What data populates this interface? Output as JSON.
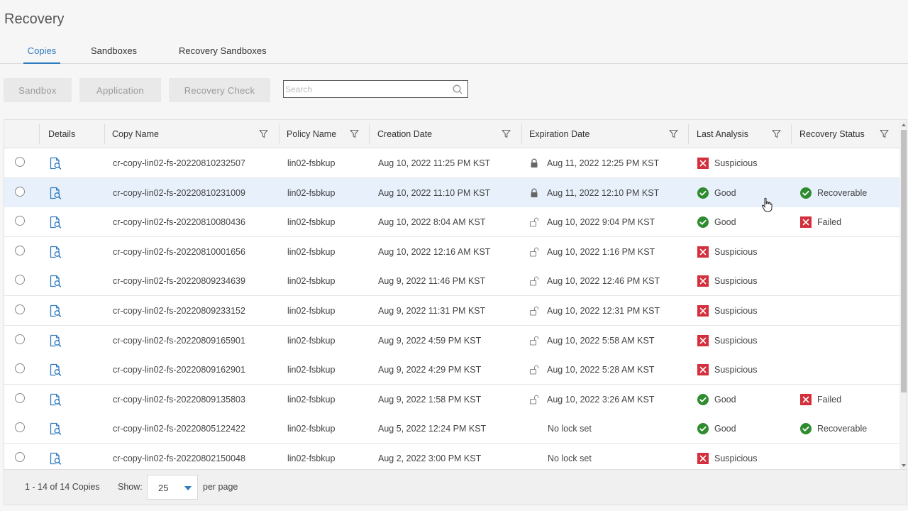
{
  "page": {
    "title": "Recovery"
  },
  "tabs": [
    {
      "label": "Copies",
      "active": true
    },
    {
      "label": "Sandboxes",
      "active": false
    },
    {
      "label": "Recovery Sandboxes",
      "active": false
    }
  ],
  "toolbar": {
    "sandbox_label": "Sandbox",
    "application_label": "Application",
    "recovery_check_label": "Recovery Check",
    "search_placeholder": "Search"
  },
  "columns": {
    "details": "Details",
    "copy_name": "Copy Name",
    "policy_name": "Policy Name",
    "creation_date": "Creation Date",
    "expiration_date": "Expiration Date",
    "last_analysis": "Last Analysis",
    "recovery_status": "Recovery Status"
  },
  "rows": [
    {
      "copy_name": "cr-copy-lin02-fs-20220810232507",
      "policy": "lin02-fsbkup",
      "created": "Aug 10, 2022 11:25 PM KST",
      "lock": "locked",
      "expires": "Aug 11, 2022 12:25 PM KST",
      "analysis": "Suspicious",
      "analysis_state": "bad",
      "recovery": "",
      "recovery_state": ""
    },
    {
      "copy_name": "cr-copy-lin02-fs-20220810231009",
      "policy": "lin02-fsbkup",
      "created": "Aug 10, 2022 11:10 PM KST",
      "lock": "locked",
      "expires": "Aug 11, 2022 12:10 PM KST",
      "analysis": "Good",
      "analysis_state": "good",
      "recovery": "Recoverable",
      "recovery_state": "good"
    },
    {
      "copy_name": "cr-copy-lin02-fs-20220810080436",
      "policy": "lin02-fsbkup",
      "created": "Aug 10, 2022 8:04 AM KST",
      "lock": "unlocked",
      "expires": "Aug 10, 2022 9:04 PM KST",
      "analysis": "Good",
      "analysis_state": "good",
      "recovery": "Failed",
      "recovery_state": "bad"
    },
    {
      "copy_name": "cr-copy-lin02-fs-20220810001656",
      "policy": "lin02-fsbkup",
      "created": "Aug 10, 2022 12:16 AM KST",
      "lock": "unlocked",
      "expires": "Aug 10, 2022 1:16 PM KST",
      "analysis": "Suspicious",
      "analysis_state": "bad",
      "recovery": "",
      "recovery_state": ""
    },
    {
      "copy_name": "cr-copy-lin02-fs-20220809234639",
      "policy": "lin02-fsbkup",
      "created": "Aug 9, 2022 11:46 PM KST",
      "lock": "unlocked",
      "expires": "Aug 10, 2022 12:46 PM KST",
      "analysis": "Suspicious",
      "analysis_state": "bad",
      "recovery": "",
      "recovery_state": ""
    },
    {
      "copy_name": "cr-copy-lin02-fs-20220809233152",
      "policy": "lin02-fsbkup",
      "created": "Aug 9, 2022 11:31 PM KST",
      "lock": "unlocked",
      "expires": "Aug 10, 2022 12:31 PM KST",
      "analysis": "Suspicious",
      "analysis_state": "bad",
      "recovery": "",
      "recovery_state": ""
    },
    {
      "copy_name": "cr-copy-lin02-fs-20220809165901",
      "policy": "lin02-fsbkup",
      "created": "Aug 9, 2022 4:59 PM KST",
      "lock": "unlocked",
      "expires": "Aug 10, 2022 5:58 AM KST",
      "analysis": "Suspicious",
      "analysis_state": "bad",
      "recovery": "",
      "recovery_state": ""
    },
    {
      "copy_name": "cr-copy-lin02-fs-20220809162901",
      "policy": "lin02-fsbkup",
      "created": "Aug 9, 2022 4:29 PM KST",
      "lock": "unlocked",
      "expires": "Aug 10, 2022 5:28 AM KST",
      "analysis": "Suspicious",
      "analysis_state": "bad",
      "recovery": "",
      "recovery_state": ""
    },
    {
      "copy_name": "cr-copy-lin02-fs-20220809135803",
      "policy": "lin02-fsbkup",
      "created": "Aug 9, 2022 1:58 PM KST",
      "lock": "unlocked",
      "expires": "Aug 10, 2022 3:26 AM KST",
      "analysis": "Good",
      "analysis_state": "good",
      "recovery": "Failed",
      "recovery_state": "bad"
    },
    {
      "copy_name": "cr-copy-lin02-fs-20220805122422",
      "policy": "lin02-fsbkup",
      "created": "Aug 5, 2022 12:24 PM KST",
      "lock": "none",
      "expires": "No lock set",
      "analysis": "Good",
      "analysis_state": "good",
      "recovery": "Recoverable",
      "recovery_state": "good"
    },
    {
      "copy_name": "cr-copy-lin02-fs-20220802150048",
      "policy": "lin02-fsbkup",
      "created": "Aug 2, 2022 3:00 PM KST",
      "lock": "none",
      "expires": "No lock set",
      "analysis": "Suspicious",
      "analysis_state": "bad",
      "recovery": "",
      "recovery_state": ""
    }
  ],
  "selected_row": 1,
  "footer": {
    "summary": "1 - 14 of 14 Copies",
    "show_label": "Show:",
    "page_size": "25",
    "per_page_label": "per page"
  },
  "colors": {
    "accent": "#2f7bbf",
    "good": "#2e8b2e",
    "bad": "#d32f3c",
    "icon_blue": "#2f7bbf"
  }
}
